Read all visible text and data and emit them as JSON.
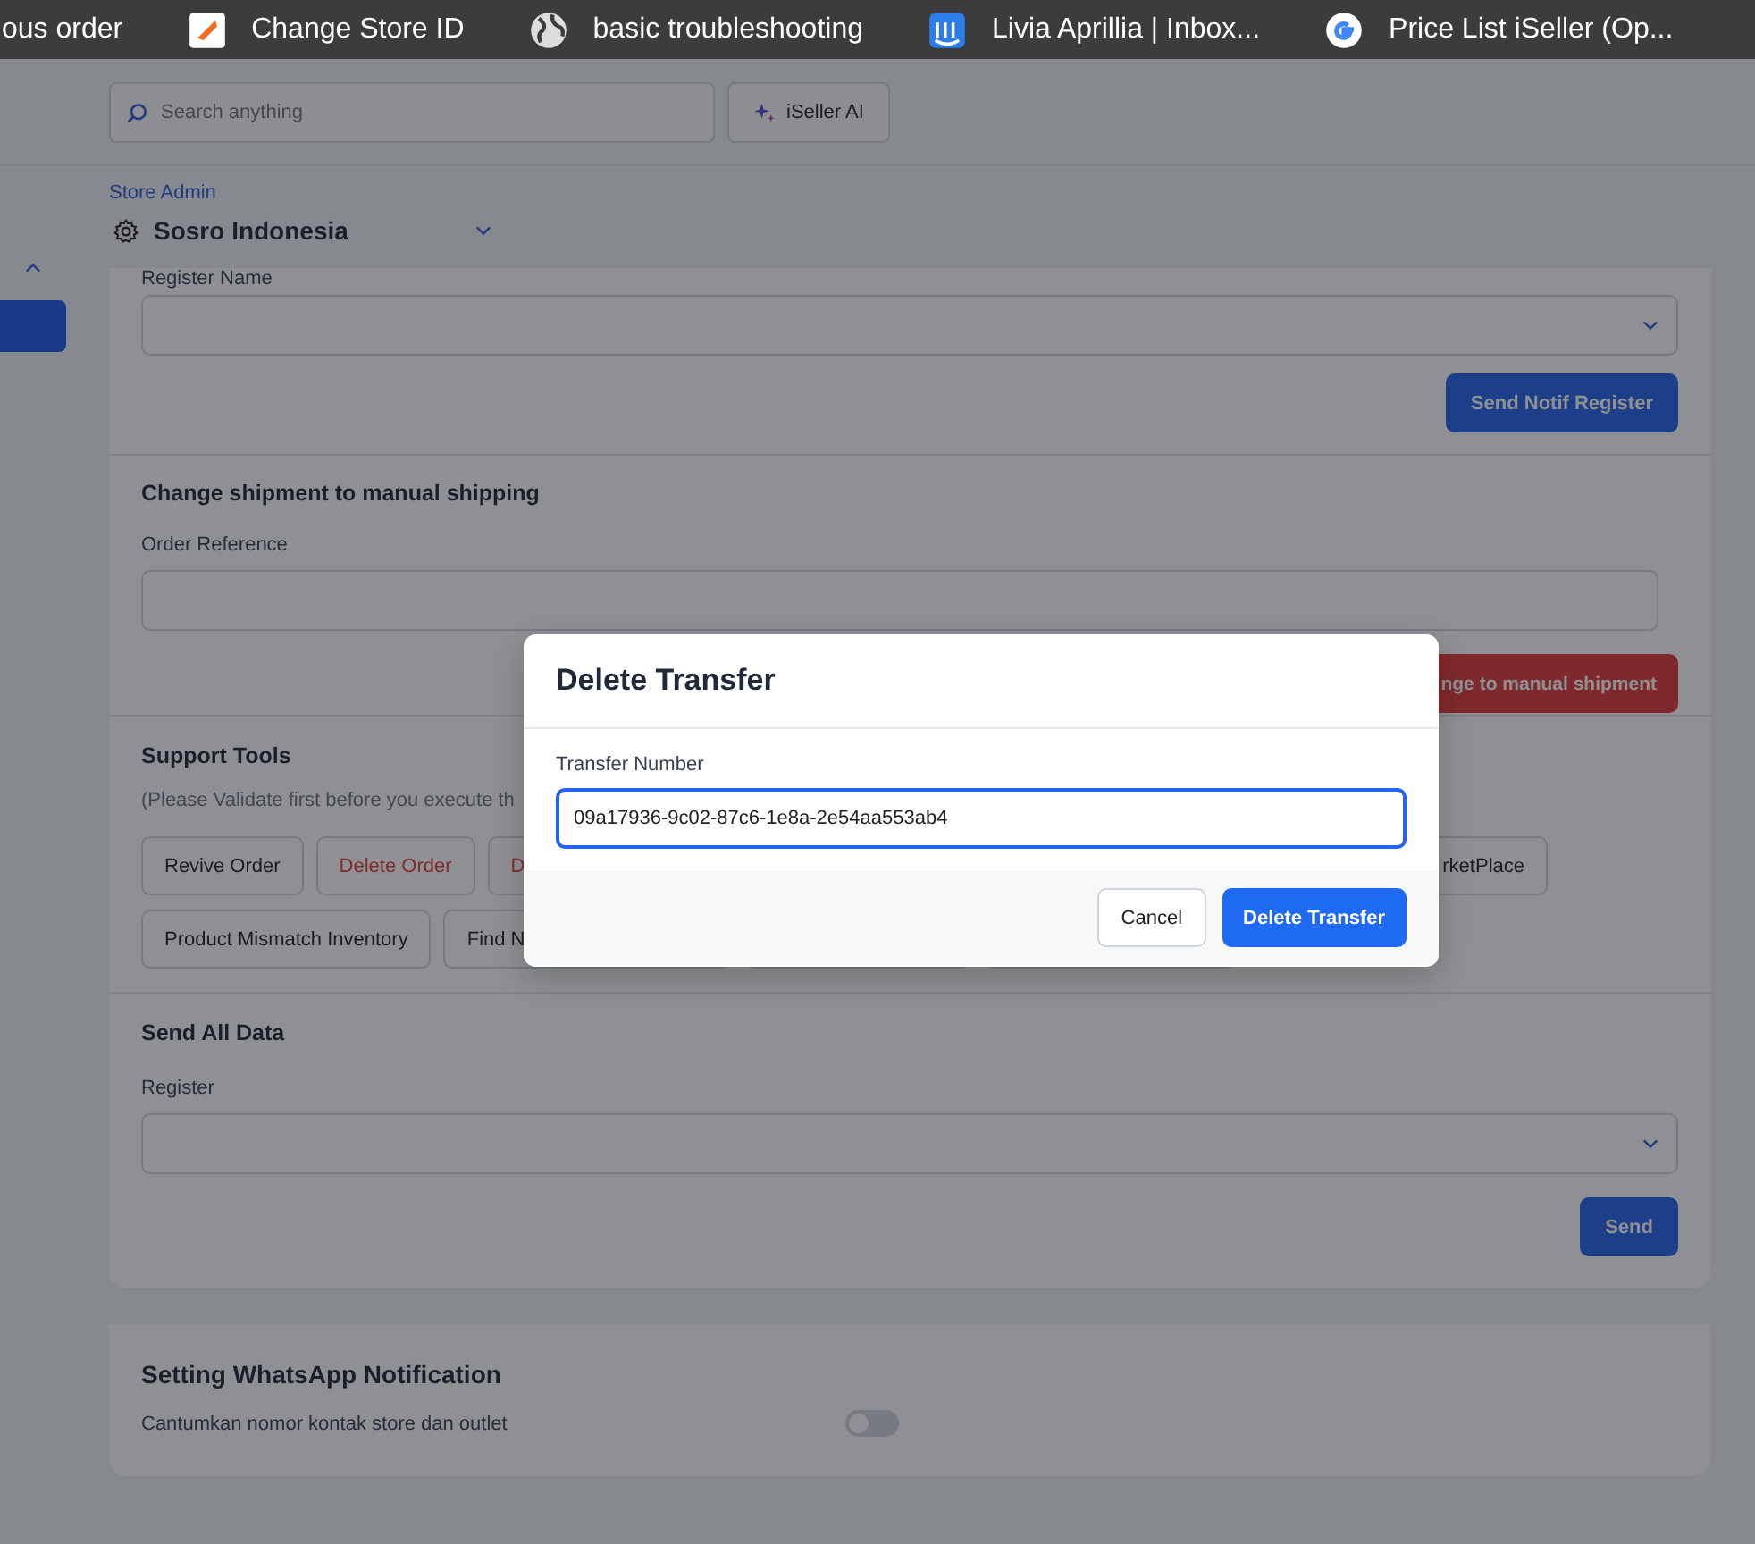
{
  "bookmarks": [
    {
      "label": "ous order"
    },
    {
      "label": "Change Store ID"
    },
    {
      "label": "basic troubleshooting"
    },
    {
      "label": "Livia Aprillia | Inbox..."
    },
    {
      "label": "Price List iSeller (Op..."
    }
  ],
  "header": {
    "search": {
      "placeholder": "Search anything"
    },
    "ai_button": "iSeller AI",
    "store_role": "Store Admin",
    "store_name": "Sosro Indonesia"
  },
  "register_section": {
    "field_label": "Register Name",
    "button": "Send Notif Register"
  },
  "shipping_section": {
    "title": "Change shipment to manual shipping",
    "field_label": "Order Reference",
    "button": "nge to manual shipment"
  },
  "support_tools": {
    "title": "Support Tools",
    "note": "(Please Validate first before you execute th",
    "buttons": [
      {
        "label": "Revive Order",
        "kind": "default"
      },
      {
        "label": "Delete Order",
        "kind": "danger"
      },
      {
        "label": "D",
        "kind": "danger_wide"
      },
      {
        "label": "rketPlace",
        "kind": "tail"
      },
      {
        "label": "Product Mismatch Inventory",
        "kind": "default"
      },
      {
        "label": "Find N",
        "kind": "wide"
      },
      {
        "kind": "blank_a"
      },
      {
        "kind": "blank_b"
      }
    ]
  },
  "send_all_data": {
    "title": "Send All Data",
    "field_label": "Register",
    "button": "Send"
  },
  "whatsapp": {
    "title": "Setting WhatsApp Notification",
    "options": [
      {
        "label": "Cantumkan nomor kontak store dan outlet",
        "on": false
      }
    ]
  },
  "modal": {
    "title": "Delete Transfer",
    "field_label": "Transfer Number",
    "value": "09a17936-9c02-87c6-1e8a-2e54aa553ab4",
    "buttons": [
      {
        "label": "Cancel",
        "kind": "secondary"
      },
      {
        "label": "Delete Transfer",
        "kind": "primary"
      }
    ]
  }
}
